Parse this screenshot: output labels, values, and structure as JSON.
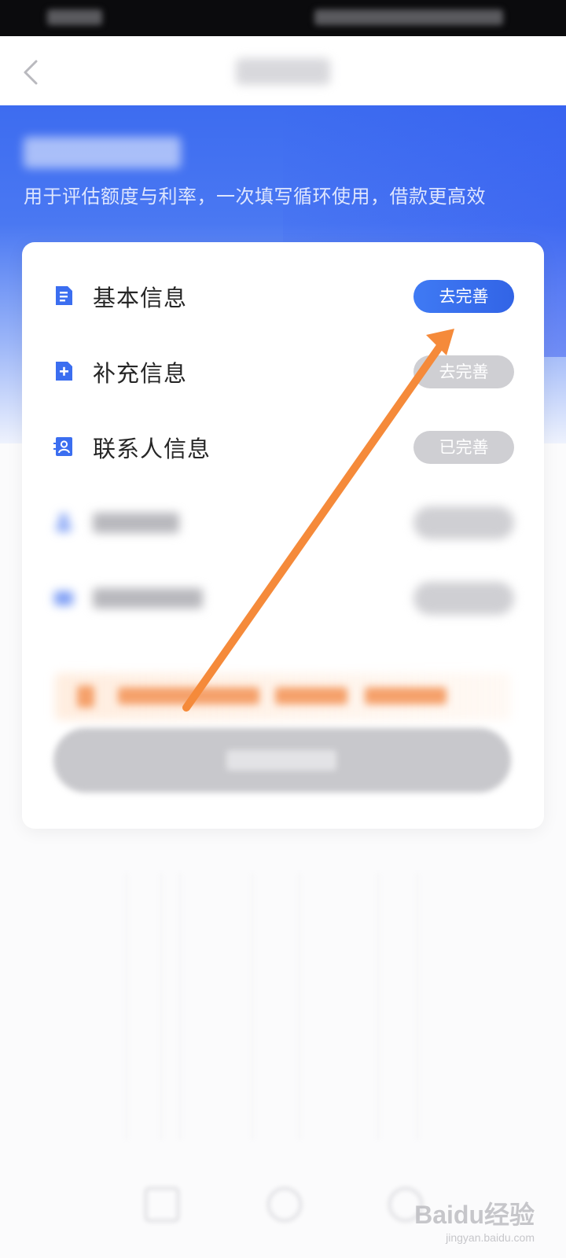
{
  "hero": {
    "subtitle": "用于评估额度与利率，一次填写循环使用，借款更高效"
  },
  "items": [
    {
      "label": "基本信息",
      "icon": "document-icon",
      "button": "去完善",
      "state": "primary"
    },
    {
      "label": "补充信息",
      "icon": "plus-document-icon",
      "button": "去完善",
      "state": "gray"
    },
    {
      "label": "联系人信息",
      "icon": "contact-card-icon",
      "button": "已完善",
      "state": "gray"
    }
  ],
  "watermark": {
    "brand": "Baidu经验",
    "url": "jingyan.baidu.com"
  },
  "colors": {
    "primary": "#3a6ff0",
    "arrow": "#f58a3a",
    "disabled": "#cfcfd3"
  }
}
